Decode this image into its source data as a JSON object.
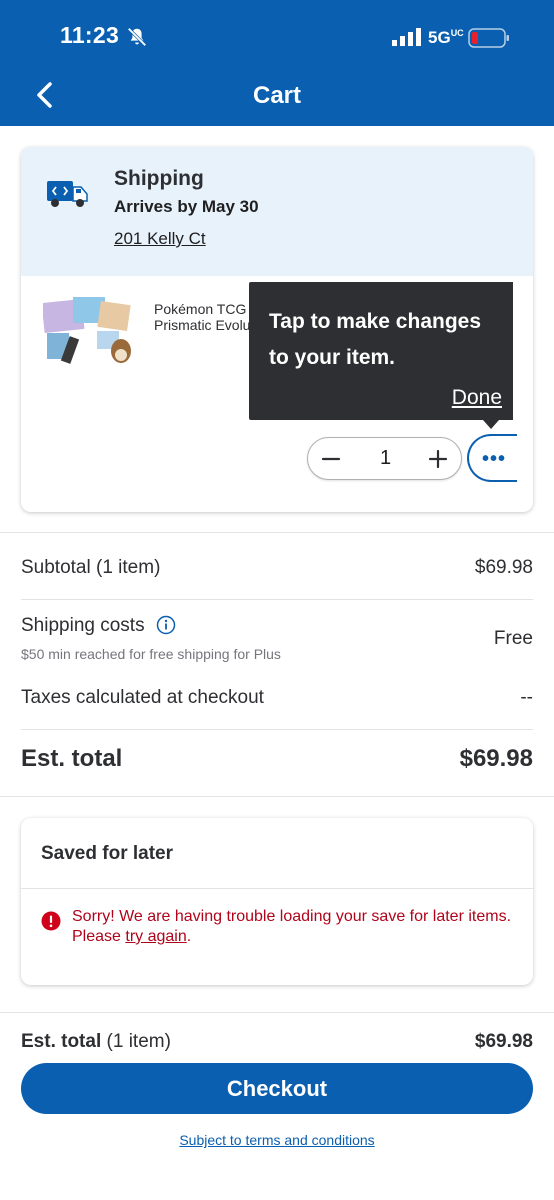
{
  "status_bar": {
    "time": "11:23",
    "network": "5G",
    "network_suffix": "UC"
  },
  "header": {
    "title": "Cart"
  },
  "shipping": {
    "title": "Shipping",
    "arrives": "Arrives by May 30",
    "address": "201 Kelly Ct"
  },
  "item": {
    "name_line1": "Pokémon TCG",
    "name_line2": "Prismatic Evolu",
    "quantity": "1"
  },
  "tooltip": {
    "text": "Tap to make changes to your item.",
    "done_label": "Done"
  },
  "summary": {
    "subtotal_label": "Subtotal (1 item)",
    "subtotal_value": "$69.98",
    "shipping_label": "Shipping costs",
    "shipping_value": "Free",
    "shipping_note": "$50 min reached for free shipping for Plus",
    "taxes_label": "Taxes calculated at checkout",
    "taxes_value": "--",
    "est_total_label": "Est. total",
    "est_total_value": "$69.98"
  },
  "saved_for_later": {
    "title": "Saved for later",
    "error_text": "Sorry! We are having trouble loading your save for later items. Please ",
    "error_link": "try again",
    "error_end": "."
  },
  "footer": {
    "est_total_label": "Est. total",
    "item_count": "(1 item)",
    "est_total_value": "$69.98",
    "checkout_label": "Checkout",
    "terms_label": "Subject to terms and conditions"
  },
  "colors": {
    "brand_blue": "#0a5fb0",
    "tooltip_bg": "#2e2f32",
    "error_red": "#b0041a",
    "shipping_band": "#e8f2fb"
  },
  "icons": [
    "bell-slash-icon",
    "signal-icon",
    "battery-icon",
    "back-chevron-icon",
    "truck-icon",
    "info-icon",
    "minus-icon",
    "plus-icon",
    "more-icon",
    "error-icon"
  ]
}
